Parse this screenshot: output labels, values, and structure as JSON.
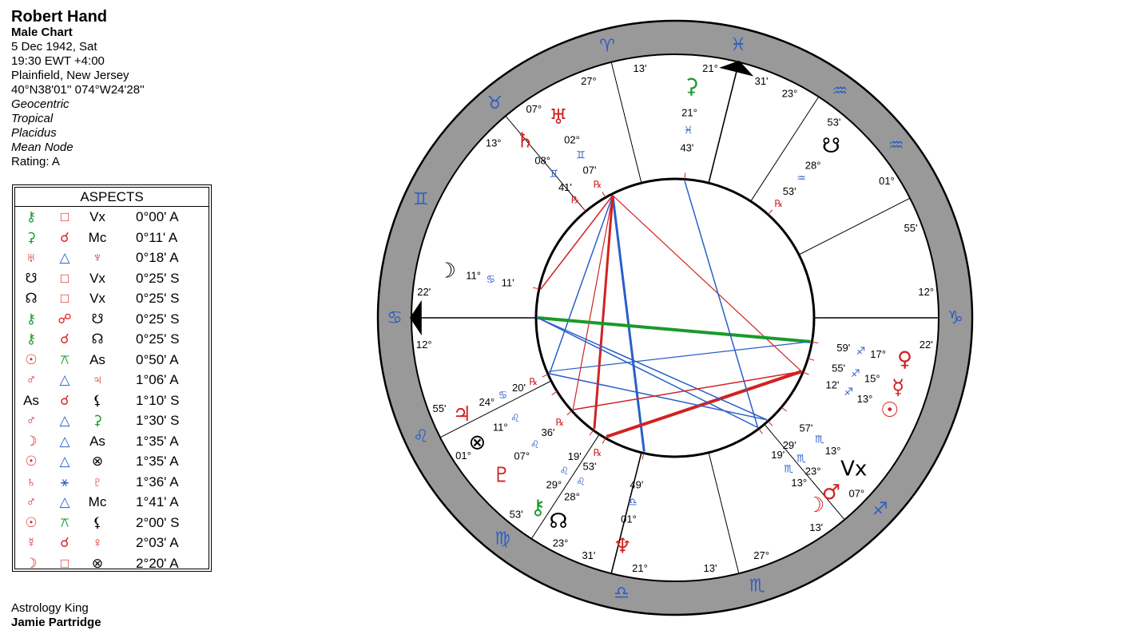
{
  "header": {
    "name": "Robert Hand",
    "chart_type": "Male Chart",
    "date": "5 Dec 1942, Sat",
    "time": "19:30  EWT +4:00",
    "place": "Plainfield, New Jersey",
    "coords": "40°N38'01'' 074°W24'28''",
    "options": [
      "Geocentric",
      "Tropical",
      "Placidus",
      "Mean Node"
    ],
    "rating": "Rating: A"
  },
  "aspects": {
    "title": "ASPECTS",
    "rows": [
      {
        "p1": "⚷",
        "p1_color": "#1a9a2a",
        "asp": "□",
        "asp_color": "#d22",
        "p2": "Vx",
        "p2_color": "#000",
        "orb": "0°00' A"
      },
      {
        "p1": "⚳",
        "p1_color": "#1a9a2a",
        "asp": "☌",
        "asp_color": "#d22",
        "p2": "Mc",
        "p2_color": "#000",
        "orb": "0°11' A"
      },
      {
        "p1": "♅",
        "p1_color": "#d22",
        "asp": "△",
        "asp_color": "#2a5fc8",
        "p2": "♆",
        "p2_color": "#d22",
        "orb": "0°18' A"
      },
      {
        "p1": "☋",
        "p1_color": "#000",
        "asp": "□",
        "asp_color": "#d22",
        "p2": "Vx",
        "p2_color": "#000",
        "orb": "0°25' S"
      },
      {
        "p1": "☊",
        "p1_color": "#000",
        "asp": "□",
        "asp_color": "#d22",
        "p2": "Vx",
        "p2_color": "#000",
        "orb": "0°25' S"
      },
      {
        "p1": "⚷",
        "p1_color": "#1a9a2a",
        "asp": "☍",
        "asp_color": "#d22",
        "p2": "☋",
        "p2_color": "#000",
        "orb": "0°25' S"
      },
      {
        "p1": "⚷",
        "p1_color": "#1a9a2a",
        "asp": "☌",
        "asp_color": "#d22",
        "p2": "☊",
        "p2_color": "#000",
        "orb": "0°25' S"
      },
      {
        "p1": "☉",
        "p1_color": "#d22",
        "asp": "⚻",
        "asp_color": "#1a9a2a",
        "p2": "As",
        "p2_color": "#000",
        "orb": "0°50' A"
      },
      {
        "p1": "♂",
        "p1_color": "#d22",
        "asp": "△",
        "asp_color": "#2a5fc8",
        "p2": "♃",
        "p2_color": "#d22",
        "orb": "1°06' A"
      },
      {
        "p1": "As",
        "p1_color": "#000",
        "asp": "☌",
        "asp_color": "#d22",
        "p2": "⚸",
        "p2_color": "#000",
        "orb": "1°10' S"
      },
      {
        "p1": "♂",
        "p1_color": "#d22",
        "asp": "△",
        "asp_color": "#2a5fc8",
        "p2": "⚳",
        "p2_color": "#1a9a2a",
        "orb": "1°30' S"
      },
      {
        "p1": "☽",
        "p1_color": "#d22",
        "asp": "△",
        "asp_color": "#2a5fc8",
        "p2": "As",
        "p2_color": "#000",
        "orb": "1°35' A"
      },
      {
        "p1": "☉",
        "p1_color": "#d22",
        "asp": "△",
        "asp_color": "#2a5fc8",
        "p2": "⊗",
        "p2_color": "#000",
        "orb": "1°35' A"
      },
      {
        "p1": "♄",
        "p1_color": "#d22",
        "asp": "⚹",
        "asp_color": "#2a5fc8",
        "p2": "♇",
        "p2_color": "#d22",
        "orb": "1°36' A"
      },
      {
        "p1": "♂",
        "p1_color": "#d22",
        "asp": "△",
        "asp_color": "#2a5fc8",
        "p2": "Mc",
        "p2_color": "#000",
        "orb": "1°41' A"
      },
      {
        "p1": "☉",
        "p1_color": "#d22",
        "asp": "⚻",
        "asp_color": "#1a9a2a",
        "p2": "⚸",
        "p2_color": "#000",
        "orb": "2°00' S"
      },
      {
        "p1": "☿",
        "p1_color": "#d22",
        "asp": "☌",
        "asp_color": "#d22",
        "p2": "♀",
        "p2_color": "#d22",
        "orb": "2°03' A"
      },
      {
        "p1": "☽",
        "p1_color": "#d22",
        "asp": "□",
        "asp_color": "#d22",
        "p2": "⊗",
        "p2_color": "#000",
        "orb": "2°20' A"
      }
    ]
  },
  "credit": {
    "line1": "Astrology King",
    "line2": "Jamie Partridge"
  },
  "wheel": {
    "asc_label": "Asc",
    "colors": {
      "ring": "#999999",
      "red": "#d22222",
      "blue": "#2a5fc8",
      "green": "#1a9a2a",
      "black": "#000000"
    },
    "zodiac": [
      {
        "glyph": "♋",
        "color": "#2a5fc8",
        "pos": "W"
      },
      {
        "glyph": "♌",
        "color": "#2a5fc8"
      },
      {
        "glyph": "♍",
        "color": "#2a5fc8"
      },
      {
        "glyph": "♎",
        "color": "#2a5fc8"
      },
      {
        "glyph": "♏",
        "color": "#2a5fc8"
      },
      {
        "glyph": "♐",
        "color": "#2a5fc8"
      },
      {
        "glyph": "♑",
        "color": "#2a5fc8"
      },
      {
        "glyph": "♒",
        "color": "#2a5fc8"
      },
      {
        "glyph": "♒",
        "color": "#2a5fc8"
      },
      {
        "glyph": "♓",
        "color": "#2a5fc8"
      },
      {
        "glyph": "♈",
        "color": "#2a5fc8"
      },
      {
        "glyph": "♉",
        "color": "#2a5fc8"
      },
      {
        "glyph": "♊",
        "color": "#2a5fc8"
      }
    ],
    "cusp_labels": [
      {
        "deg": "12°",
        "min": "22'",
        "sign": "♋"
      },
      {
        "deg": "01°",
        "min": "55'",
        "sign": "♌"
      },
      {
        "deg": "23°",
        "min": "53'",
        "sign": "♌"
      },
      {
        "deg": "21°",
        "min": "31'",
        "sign": "♍"
      },
      {
        "deg": "27°",
        "min": "13'",
        "sign": "♎"
      },
      {
        "deg": "07°",
        "min": "13'",
        "sign": "♐"
      },
      {
        "deg": "12°",
        "min": "22'",
        "sign": "♑"
      },
      {
        "deg": "01°",
        "min": "55'",
        "sign": "♒"
      },
      {
        "deg": "23°",
        "min": "53'",
        "sign": "♒"
      },
      {
        "deg": "21°",
        "min": "31'",
        "sign": "♓"
      },
      {
        "deg": "27°",
        "min": "13'",
        "sign": "♈"
      },
      {
        "deg": "13°",
        "min": "07°",
        "sign": "♊"
      }
    ],
    "planets": [
      {
        "glyph": "☽",
        "color": "#000",
        "deg": "11°",
        "sign": "♋",
        "min": "11'",
        "retro": ""
      },
      {
        "glyph": "♃",
        "color": "#d22222",
        "deg": "24°",
        "sign": "♋",
        "min": "20'",
        "retro": "℞"
      },
      {
        "glyph": "♇",
        "color": "#d22222",
        "deg": "07°",
        "sign": "♌",
        "min": "36'",
        "retro": "℞"
      },
      {
        "glyph": "⊗",
        "color": "#000",
        "deg": "11°",
        "sign": "♌",
        "min": "",
        "retro": ""
      },
      {
        "glyph": "☊",
        "color": "#000",
        "deg": "28°",
        "sign": "♌",
        "min": "53'",
        "retro": "℞"
      },
      {
        "glyph": "⚷",
        "color": "#1a9a2a",
        "deg": "29°",
        "sign": "♌",
        "min": "19'",
        "retro": ""
      },
      {
        "glyph": "♆",
        "color": "#d22222",
        "deg": "01°",
        "sign": "♎",
        "min": "49'",
        "retro": ""
      },
      {
        "glyph": "☽",
        "color": "#d22222",
        "deg": "13°",
        "sign": "♏",
        "min": "19'",
        "retro": ""
      },
      {
        "glyph": "♂",
        "color": "#d22222",
        "deg": "23°",
        "sign": "♏",
        "min": "29'",
        "retro": ""
      },
      {
        "glyph": "Vx",
        "color": "#000",
        "deg": "13°",
        "sign": "♏",
        "min": "57'",
        "retro": ""
      },
      {
        "glyph": "☉",
        "color": "#d22222",
        "deg": "13°",
        "sign": "♐",
        "min": "12'",
        "retro": ""
      },
      {
        "glyph": "☿",
        "color": "#d22222",
        "deg": "15°",
        "sign": "♐",
        "min": "55'",
        "retro": ""
      },
      {
        "glyph": "♀",
        "color": "#d22222",
        "deg": "17°",
        "sign": "♐",
        "min": "59'",
        "retro": ""
      },
      {
        "glyph": "☋",
        "color": "#000",
        "deg": "28°",
        "sign": "♒",
        "min": "53'",
        "retro": "℞"
      },
      {
        "glyph": "⚳",
        "color": "#1a9a2a",
        "deg": "21°",
        "sign": "♓",
        "min": "43'",
        "retro": ""
      },
      {
        "glyph": "♅",
        "color": "#d22222",
        "deg": "02°",
        "sign": "♊",
        "min": "07'",
        "retro": "℞"
      },
      {
        "glyph": "♄",
        "color": "#d22222",
        "deg": "08°",
        "sign": "♊",
        "min": "41'",
        "retro": "℞"
      }
    ]
  }
}
